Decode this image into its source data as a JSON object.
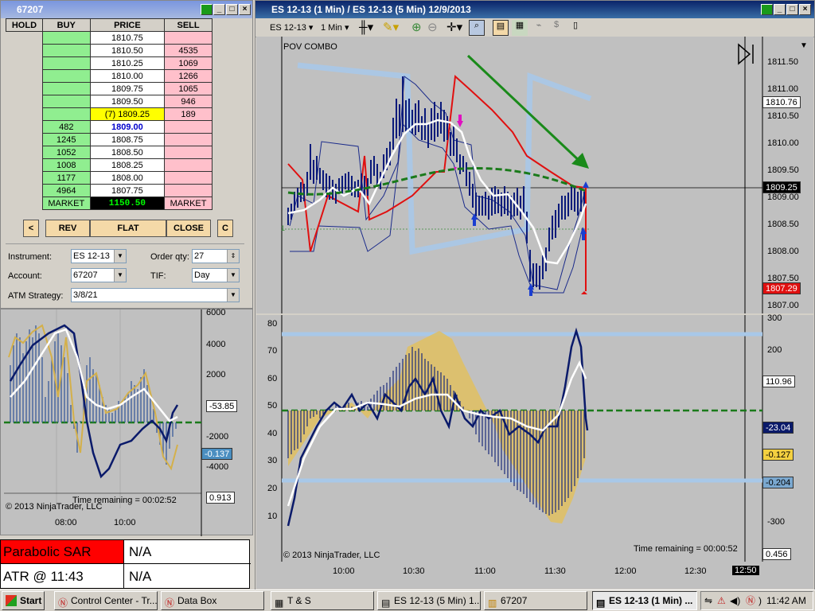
{
  "dom_window": {
    "title": "67207",
    "hold": "HOLD",
    "buy": "BUY",
    "price": "PRICE",
    "sell": "SELL",
    "rows": [
      {
        "buy": "",
        "price": "1810.75",
        "sell": ""
      },
      {
        "buy": "",
        "price": "1810.50",
        "sell": "4535"
      },
      {
        "buy": "",
        "price": "1810.25",
        "sell": "1069"
      },
      {
        "buy": "",
        "price": "1810.00",
        "sell": "1266"
      },
      {
        "buy": "",
        "price": "1809.75",
        "sell": "1065"
      },
      {
        "buy": "",
        "price": "1809.50",
        "sell": "946"
      },
      {
        "buy": "",
        "price": "(7) 1809.25",
        "sell": "189"
      },
      {
        "buy": "482",
        "price": "1809.00",
        "sell": ""
      },
      {
        "buy": "1245",
        "price": "1808.75",
        "sell": ""
      },
      {
        "buy": "1052",
        "price": "1808.50",
        "sell": ""
      },
      {
        "buy": "1008",
        "price": "1808.25",
        "sell": ""
      },
      {
        "buy": "1177",
        "price": "1808.00",
        "sell": ""
      },
      {
        "buy": "4964",
        "price": "1807.75",
        "sell": ""
      }
    ],
    "market_buy": "MARKET",
    "market_price": "1150.50",
    "market_sell": "MARKET",
    "btn_left": "<",
    "btn_rev": "REV",
    "btn_flat": "FLAT",
    "btn_close": "CLOSE",
    "btn_c": "C",
    "instrument_label": "Instrument:",
    "instrument_value": "ES 12-13",
    "orderqty_label": "Order qty:",
    "orderqty_value": "27",
    "account_label": "Account:",
    "account_value": "67207",
    "tif_label": "TIF:",
    "tif_value": "Day",
    "atm_label": "ATM Strategy:",
    "atm_value": "3/8/21"
  },
  "mini_chart": {
    "y_labels": [
      "6000",
      "4000",
      "2000",
      "-2000",
      "-4000"
    ],
    "tag1": "-53.85",
    "tag2": "-0.137",
    "tag3": "0.913",
    "time_remaining": "Time remaining = 00:02:52",
    "copyright": "© 2013 NinjaTrader, LLC",
    "x_labels": [
      "08:00",
      "10:00"
    ]
  },
  "info_table": {
    "row1_label": "Parabolic SAR",
    "row1_value": "N/A",
    "row2_label": "ATR @ 11:43",
    "row2_value": "N/A"
  },
  "chart_window": {
    "title": "ES 12-13 (1 Min) / ES 12-13 (5 Min)  12/9/2013",
    "instrument": "ES 12-13",
    "interval": "1 Min",
    "indicator_label": "POV COMBO",
    "price_labels": [
      "1811.50",
      "1811.00",
      "1810.50",
      "1810.00",
      "1809.50",
      "1809.00",
      "1808.50",
      "1808.00",
      "1807.50",
      "1807.00"
    ],
    "tag_1810_76": "1810.76",
    "tag_1809_25": "1809.25",
    "tag_1807_29": "1807.29",
    "osc_left_labels": [
      "80",
      "70",
      "60",
      "50",
      "40",
      "30",
      "20",
      "10"
    ],
    "osc_right_labels": [
      "300",
      "200",
      "100",
      "0",
      "-100",
      "-200",
      "-300"
    ],
    "tag_110_96": "110.96",
    "tag_m23_04": "-23.04",
    "tag_m0_127": "-0.127",
    "tag_m0_204": "-0.204",
    "tag_0_456": "0.456",
    "time_remaining": "Time remaining = 00:00:52",
    "copyright": "© 2013 NinjaTrader, LLC",
    "x_labels": [
      "10:00",
      "10:30",
      "11:00",
      "11:30",
      "12:00",
      "12:30",
      "12:50"
    ]
  },
  "taskbar": {
    "start": "Start",
    "items": [
      "Control Center - Tr...",
      "Data Box",
      "T & S",
      "ES 12-13 (5 Min)  1...",
      "67207",
      "ES 12-13 (1 Min) ..."
    ],
    "clock": "11:42 AM"
  },
  "colors": {
    "buy_green": "#90ee90",
    "sell_pink": "#ffc0cb",
    "price_highlight": "#ffff00",
    "price_blue": "#0000cc",
    "up_arrow": "#1a3ed1",
    "red_line": "#e01010",
    "green_line": "#1a8a1a"
  }
}
